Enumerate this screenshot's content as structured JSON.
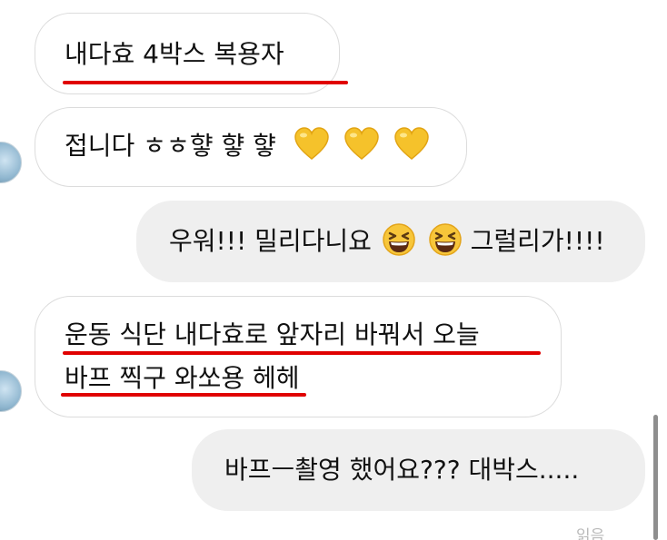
{
  "messages": [
    {
      "from": "other",
      "lines": [
        "내다효 4박스 복용자"
      ]
    },
    {
      "from": "other",
      "text": "접니다 ㅎㅎ햫 햫 햫",
      "emoji": [
        "yellow-heart",
        "yellow-heart",
        "yellow-heart"
      ]
    },
    {
      "from": "me",
      "prefix": "우워!!! 밀리다니요",
      "suffix": "그럴리가!!!!",
      "emoji": [
        "grinning-squinting-face",
        "grinning-squinting-face"
      ]
    },
    {
      "from": "other",
      "lines": [
        "운동 식단 내다효로 앞자리 바꿔서 오늘",
        "바프 찍구 와쏘용 헤헤"
      ]
    },
    {
      "from": "me",
      "lines": [
        "바프ㅡ촬영 했어요??? 대박스....."
      ]
    }
  ],
  "read_receipt": "읽음",
  "colors": {
    "underline": "#e00000",
    "sent_bubble": "#efefef",
    "received_border": "#dcdcdc",
    "heart": "#f5c22b"
  }
}
